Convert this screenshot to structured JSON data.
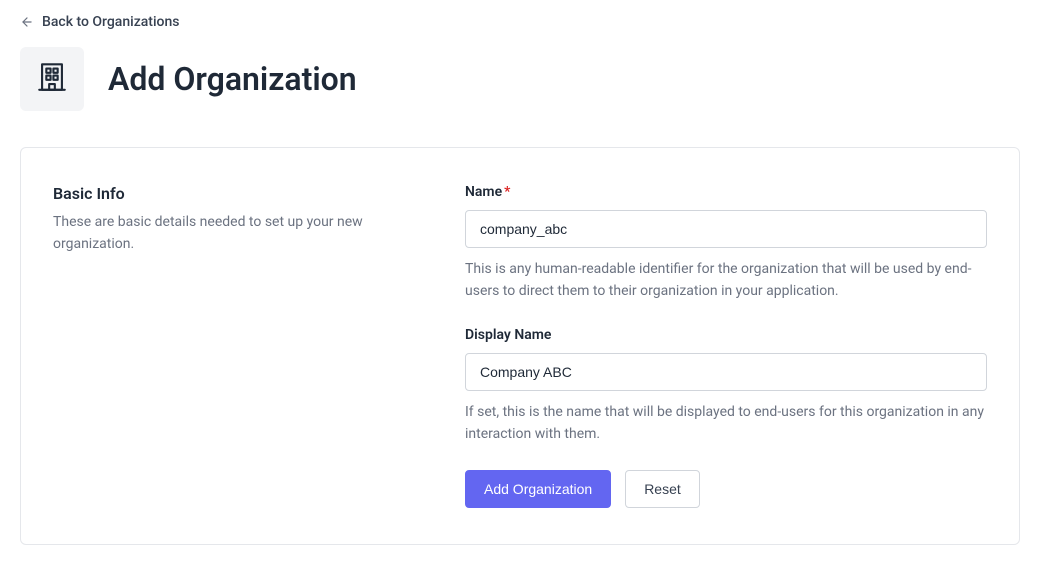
{
  "back": {
    "label": "Back to Organizations"
  },
  "header": {
    "title": "Add Organization"
  },
  "section": {
    "title": "Basic Info",
    "description": "These are basic details needed to set up your new organization."
  },
  "form": {
    "name": {
      "label": "Name",
      "value": "company_abc",
      "help": "This is any human-readable identifier for the organization that will be used by end-users to direct them to their organization in your application."
    },
    "display_name": {
      "label": "Display Name",
      "value": "Company ABC",
      "help": "If set, this is the name that will be displayed to end-users for this organization in any interaction with them."
    }
  },
  "buttons": {
    "submit": "Add Organization",
    "reset": "Reset"
  }
}
